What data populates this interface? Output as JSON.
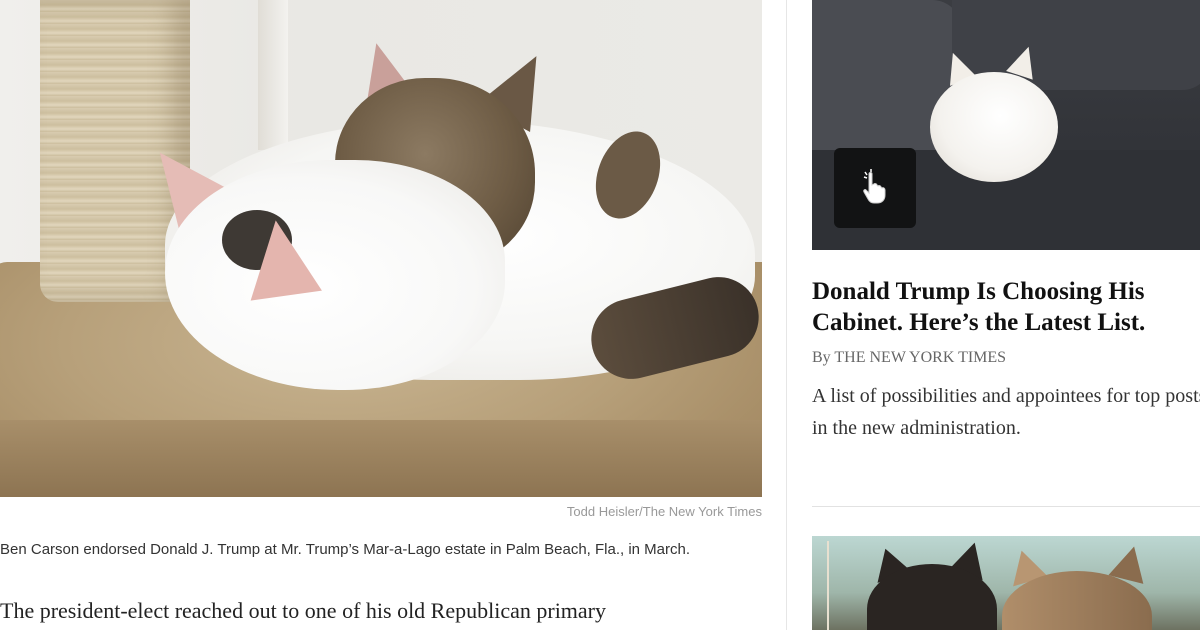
{
  "main": {
    "photo_credit": "Todd Heisler/The New York Times",
    "caption": "Ben Carson endorsed Donald J. Trump at Mr. Trump’s Mar-a-Lago estate in Palm Beach, Fla., in March.",
    "lede": "The president-elect reached out to one of his old Republican primary"
  },
  "sidebar": {
    "story1": {
      "headline": "Donald Trump Is Choosing His Cabinet. Here’s the Latest List.",
      "byline": "By THE NEW YORK TIMES",
      "summary": "A list of possibilities and appointees for top posts in the new administration.",
      "gif_icon": "hand-pointer-icon"
    }
  },
  "colors": {
    "headline": "#111111",
    "byline": "#666666",
    "credit": "#999999"
  }
}
